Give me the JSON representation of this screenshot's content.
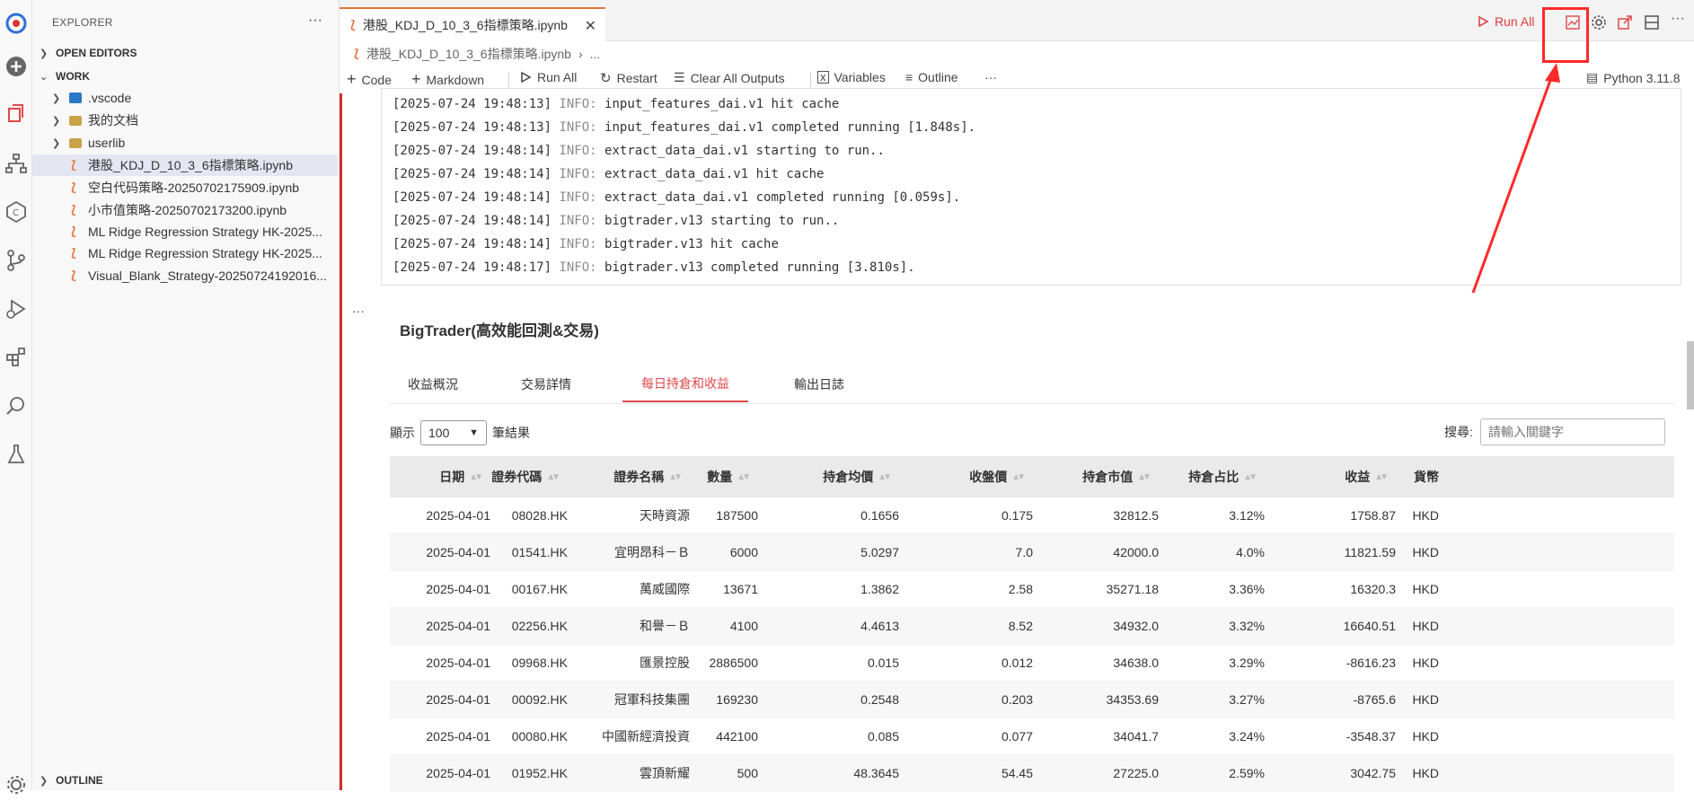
{
  "sidebar": {
    "title": "EXPLORER",
    "more": "···",
    "open_editors": "OPEN EDITORS",
    "work": "WORK",
    "outline": "OUTLINE",
    "items": [
      {
        "label": ".vscode",
        "kind": "folder-vscode"
      },
      {
        "label": "我的文档",
        "kind": "folder"
      },
      {
        "label": "userlib",
        "kind": "folder"
      },
      {
        "label": "港股_KDJ_D_10_3_6指標策略.ipynb",
        "kind": "notebook"
      },
      {
        "label": "空白代码策略-20250702175909.ipynb",
        "kind": "notebook"
      },
      {
        "label": "小市值策略-20250702173200.ipynb",
        "kind": "notebook"
      },
      {
        "label": "ML Ridge Regression Strategy HK-2025...",
        "kind": "notebook"
      },
      {
        "label": "ML Ridge Regression Strategy HK-2025...",
        "kind": "notebook"
      },
      {
        "label": "Visual_Blank_Strategy-20250724192016...",
        "kind": "notebook"
      }
    ]
  },
  "tab": {
    "title": "港股_KDJ_D_10_3_6指標策略.ipynb",
    "close": "✕"
  },
  "breadcrumb": {
    "file": "港股_KDJ_D_10_3_6指標策略.ipynb",
    "more": "..."
  },
  "top_actions": {
    "run_all": "Run All"
  },
  "toolbar": {
    "code": "Code",
    "markdown": "Markdown",
    "run_all": "Run All",
    "restart": "Restart",
    "clear_outputs": "Clear All Outputs",
    "variables": "Variables",
    "outline": "Outline",
    "more": "···",
    "kernel": "Python 3.11.8"
  },
  "log": [
    {
      "ts": "[2025-07-24 19:48:13]",
      "level": "INFO:",
      "msg": "input_features_dai.v1 hit cache"
    },
    {
      "ts": "[2025-07-24 19:48:13]",
      "level": "INFO:",
      "msg": "input_features_dai.v1 completed running [1.848s]."
    },
    {
      "ts": "[2025-07-24 19:48:14]",
      "level": "INFO:",
      "msg": "extract_data_dai.v1 starting to run.."
    },
    {
      "ts": "[2025-07-24 19:48:14]",
      "level": "INFO:",
      "msg": "extract_data_dai.v1 hit cache"
    },
    {
      "ts": "[2025-07-24 19:48:14]",
      "level": "INFO:",
      "msg": "extract_data_dai.v1 completed running [0.059s]."
    },
    {
      "ts": "[2025-07-24 19:48:14]",
      "level": "INFO:",
      "msg": "bigtrader.v13 starting to run.."
    },
    {
      "ts": "[2025-07-24 19:48:14]",
      "level": "INFO:",
      "msg": "bigtrader.v13 hit cache"
    },
    {
      "ts": "[2025-07-24 19:48:17]",
      "level": "INFO:",
      "msg": "bigtrader.v13 completed running [3.810s]."
    }
  ],
  "cell_more": "···",
  "report": {
    "title": "BigTrader(高效能回測&交易)",
    "tabs": [
      "收益概況",
      "交易詳情",
      "每日持倉和收益",
      "輸出日誌"
    ],
    "active_tab": 2,
    "show_label": "顯示",
    "show_value": "100",
    "show_suffix": "筆結果",
    "search_label": "搜尋:",
    "search_placeholder": "請輸入關鍵字",
    "columns": [
      "日期",
      "證券代碼",
      "證券名稱",
      "數量",
      "持倉均價",
      "收盤價",
      "持倉市值",
      "持倉占比",
      "收益",
      "貨幣"
    ],
    "rows": [
      [
        "2025-04-01",
        "08028.HK",
        "天時資源",
        "187500",
        "0.1656",
        "0.175",
        "32812.5",
        "3.12%",
        "1758.87",
        "HKD"
      ],
      [
        "2025-04-01",
        "01541.HK",
        "宜明昂科－Ｂ",
        "6000",
        "5.0297",
        "7.0",
        "42000.0",
        "4.0%",
        "11821.59",
        "HKD"
      ],
      [
        "2025-04-01",
        "00167.HK",
        "萬威國際",
        "13671",
        "1.3862",
        "2.58",
        "35271.18",
        "3.36%",
        "16320.3",
        "HKD"
      ],
      [
        "2025-04-01",
        "02256.HK",
        "和譽－Ｂ",
        "4100",
        "4.4613",
        "8.52",
        "34932.0",
        "3.32%",
        "16640.51",
        "HKD"
      ],
      [
        "2025-04-01",
        "09968.HK",
        "匯景控股",
        "2886500",
        "0.015",
        "0.012",
        "34638.0",
        "3.29%",
        "-8616.23",
        "HKD"
      ],
      [
        "2025-04-01",
        "00092.HK",
        "冠軍科技集團",
        "169230",
        "0.2548",
        "0.203",
        "34353.69",
        "3.27%",
        "-8765.6",
        "HKD"
      ],
      [
        "2025-04-01",
        "00080.HK",
        "中國新經濟投資",
        "442100",
        "0.085",
        "0.077",
        "34041.7",
        "3.24%",
        "-3548.37",
        "HKD"
      ],
      [
        "2025-04-01",
        "01952.HK",
        "雲頂新耀",
        "500",
        "48.3645",
        "54.45",
        "27225.0",
        "2.59%",
        "3042.75",
        "HKD"
      ]
    ]
  },
  "colors": {
    "accent": "#e04848",
    "highlight": "#ff2a2a",
    "notebook_icon": "#e5743a"
  }
}
